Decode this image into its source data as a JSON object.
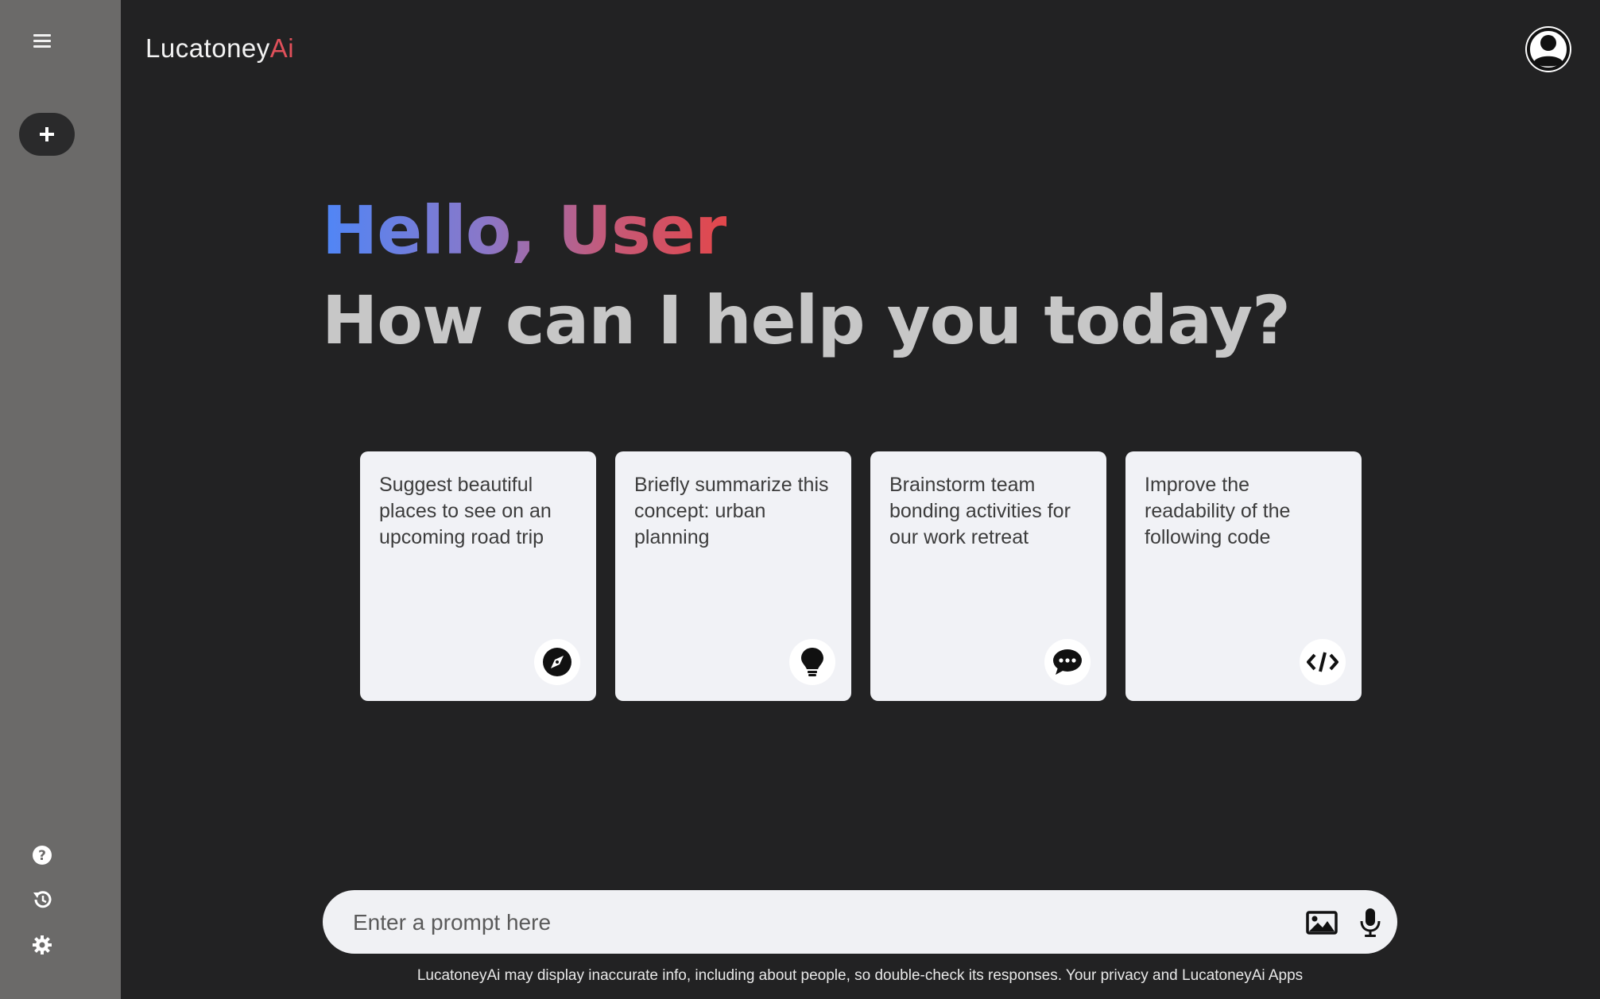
{
  "brand": {
    "name": "Lucatoney",
    "accent": "Ai",
    "accent_color": "#e0505a"
  },
  "sidebar": {
    "menu_icon": "hamburger-menu-icon",
    "new_chat_icon": "plus-icon",
    "bottom_items": [
      {
        "name": "help",
        "icon": "question-circle-icon"
      },
      {
        "name": "activity",
        "icon": "history-icon"
      },
      {
        "name": "settings",
        "icon": "gear-icon"
      }
    ]
  },
  "greeting": {
    "hello": "Hello, User",
    "subtitle": "How can I help you today?",
    "gradient_colors": [
      "#4f86f7",
      "#8a77c8",
      "#c45a7a",
      "#e2474b"
    ]
  },
  "cards": [
    {
      "text": "Suggest beautiful places to see on an upcoming road trip",
      "icon": "compass-icon"
    },
    {
      "text": "Briefly summarize this concept: urban planning",
      "icon": "lightbulb-icon"
    },
    {
      "text": "Brainstorm team bonding activities for our work retreat",
      "icon": "chat-bubble-icon"
    },
    {
      "text": "Improve the readability of the following code",
      "icon": "code-icon"
    }
  ],
  "prompt": {
    "placeholder": "Enter a prompt here",
    "image_icon": "image-icon",
    "mic_icon": "microphone-icon"
  },
  "disclaimer": {
    "text": "LucatoneyAi may display inaccurate info, including about people, so double-check its responses. ",
    "link": "Your privacy and LucatoneyAi Apps"
  },
  "colors": {
    "background": "#222223",
    "sidebar": "#6b6a69",
    "card": "#f1f2f6",
    "subtitle": "#c7c7c7"
  }
}
